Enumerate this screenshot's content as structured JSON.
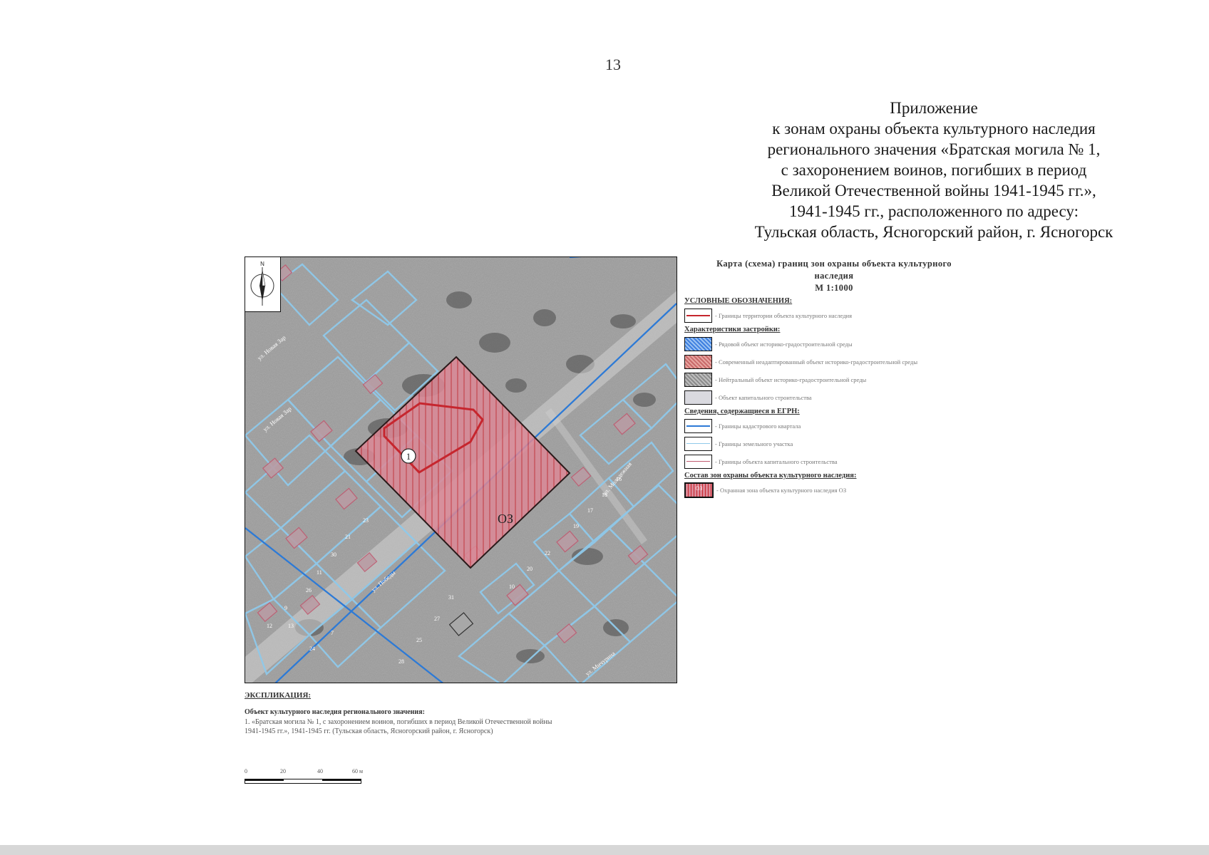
{
  "page_number": "13",
  "appendix": {
    "lines": [
      "Приложение",
      "к зонам охраны объекта культурного наследия",
      "регионального значения «Братская могила № 1,",
      "с захоронением воинов, погибших в период",
      "Великой Отечественной войны 1941-1945 гг.»,",
      "1941-1945 гг., расположенного по адресу:",
      "Тульская область, Ясногорский район, г. Ясногорск"
    ]
  },
  "map": {
    "north_label": "N",
    "object_marker": "1",
    "zone_label": "ОЗ",
    "streets": [
      {
        "name": "ул. Новая Зар"
      },
      {
        "name": "ул. Новая Зар"
      },
      {
        "name": "ул. Победы"
      },
      {
        "name": "ул. Молодежная"
      },
      {
        "name": "ул. Мичурина"
      }
    ],
    "parcel_numbers": [
      "12",
      "9",
      "26",
      "11",
      "30",
      "21",
      "23",
      "13",
      "7",
      "24",
      "10",
      "20",
      "22",
      "19",
      "17",
      "18",
      "16",
      "31",
      "27",
      "25",
      "28"
    ]
  },
  "legend": {
    "title_line1": "Карта (схема) границ зон охраны объекта культурного",
    "title_line2": "наследия",
    "scale": "М 1:1000",
    "heading_symbols": "УСЛОВНЫЕ ОБОЗНАЧЕНИЯ:",
    "item_territory": "- Границы территории объекта культурного наследия",
    "heading_buildings": "Характеристики застройки:",
    "item_ordinary": "- Рядовой объект историко-градостроительной среды",
    "item_modern": "- Современный неадаптированный объект историко-градостроительной среды",
    "item_neutral": "- Нейтральный объект историко-градостроительной среды",
    "item_capital": "- Объект капитального строительства",
    "heading_egrn": "Сведения, содержащиеся в ЕГРН:",
    "item_cadastral": "- Границы кадастрового квартала",
    "item_land": "- Границы земельного участка",
    "item_capital_bounds": "- Границы объекта капитального строительства",
    "heading_zones": "Состав зон охраны объекта культурного наследия:",
    "item_zone": "- Охранная зона объекта культурного наследия ОЗ",
    "zone_swatch_label": "ОЗ"
  },
  "explication": {
    "heading": "ЭКСПЛИКАЦИЯ:",
    "subheading": "Объект культурного наследия регионального значения:",
    "line1": "1. «Братская могила № 1, с захоронением воинов, погибших в период Великой Отечественной войны",
    "line2": "1941-1945 гг.», 1941-1945 гг. (Тульская область, Ясногорский район, г. Ясногорск)"
  },
  "scale_bar": {
    "ticks": [
      "0",
      "20",
      "40",
      "60 м"
    ]
  },
  "colors": {
    "zone_fill": "#e08a98",
    "zone_line": "#c6262e",
    "cadastral": "#2d7ad6",
    "parcel": "#8fc9ea",
    "ordinary_fill": "#3d7fe0"
  }
}
